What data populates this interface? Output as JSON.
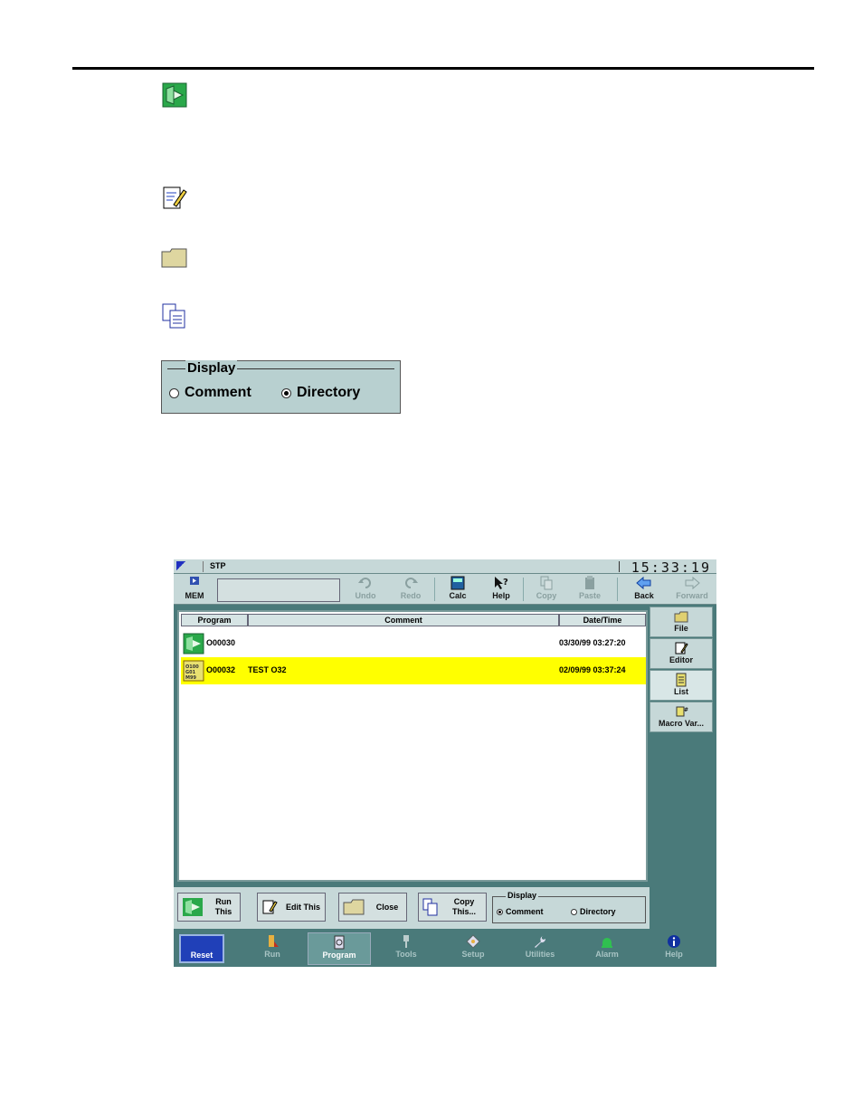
{
  "screen": {
    "status": {
      "mode": "STP",
      "clock": "15:33:19"
    },
    "toolbar": {
      "mem_label": "MEM",
      "undo": "Undo",
      "redo": "Redo",
      "calc": "Calc",
      "help": "Help",
      "copy": "Copy",
      "paste": "Paste",
      "back": "Back",
      "forward": "Forward"
    },
    "list": {
      "columns": [
        "Program",
        "Comment",
        "Date/Time"
      ],
      "rows": [
        {
          "program": "O00030",
          "comment": "",
          "datetime": "03/30/99 03:27:20"
        },
        {
          "program": "O00032",
          "comment": "TEST O32",
          "datetime": "02/09/99 03:37:24"
        }
      ]
    },
    "side_tabs": [
      "File",
      "Editor",
      "List",
      "Macro Var..."
    ],
    "bottom": {
      "run": "Run\nThis",
      "edit": "Edit This",
      "close": "Close",
      "copy": "Copy\nThis...",
      "display_legend": "Display",
      "display_comment": "Comment",
      "display_directory": "Directory"
    },
    "nav": {
      "reset": "Reset",
      "items": [
        "Run",
        "Program",
        "Tools",
        "Setup",
        "Utilities",
        "Alarm",
        "Help"
      ]
    }
  },
  "display_panel": {
    "legend": "Display",
    "comment": "Comment",
    "directory": "Directory"
  }
}
